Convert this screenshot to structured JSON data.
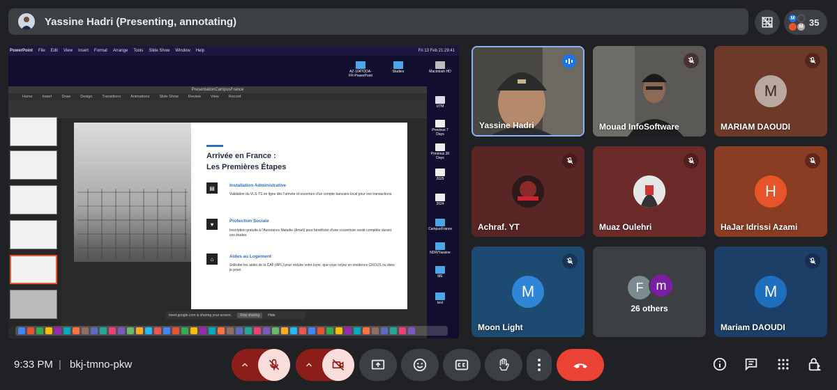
{
  "header": {
    "presenter_title": "Yassine Hadri (Presenting, annotating)",
    "participant_count": "35",
    "people_avatars": [
      "M",
      "M"
    ]
  },
  "presentation": {
    "mac_menu": [
      "PowerPoint",
      "File",
      "Edit",
      "View",
      "Insert",
      "Format",
      "Arrange",
      "Tools",
      "Slide Show",
      "Window",
      "Help"
    ],
    "mac_status": "Fri 13 Feb 21:29:41",
    "window_title": "PresentationCampusFrance",
    "tabs": [
      "Home",
      "Insert",
      "Draw",
      "Design",
      "Transitions",
      "Animations",
      "Slide Show",
      "Review",
      "View",
      "Record"
    ],
    "slide": {
      "title_line1": "Arrivée en France :",
      "title_line2": "Les Premières Étapes",
      "items": [
        {
          "heading": "Installation Administrative",
          "body": "Validation du VLS-TS en ligne dès l'arrivée et ouverture d'un compte bancaire local pour vos transactions."
        },
        {
          "heading": "Protection Sociale",
          "body": "Inscription gratuite à l'Assurance Maladie (Ameli) pour bénéficier d'une couverture santé complète durant vos études."
        },
        {
          "heading": "Aides au Logement",
          "body": "Solliciter les aides de la CAF (APL) pour réduire votre loyer, que vous soyez en résidence CROUS ou dans le privé."
        }
      ]
    },
    "share_notice": "meet.google.com is sharing your screen.",
    "stop_sharing": "Stop sharing",
    "hide": "Hide",
    "desktop_icons": [
      "AZ-104TODA-FR-PowerPoint",
      "Studies",
      "Macintosh HD",
      "UTM",
      "Previous 7 Days",
      "Previous 30 Days",
      "2025",
      "2024",
      "CampusFrance",
      "NDR/Yassine",
      "ME",
      "test"
    ]
  },
  "participants": [
    {
      "name": "Yassine Hadri",
      "type": "video",
      "speaking": true
    },
    {
      "name": "Mouad InfoSoftware",
      "type": "video",
      "muted": true
    },
    {
      "name": "MARIAM DAOUDI",
      "type": "avatar",
      "initial": "M",
      "muted": true,
      "bg": "#6d3a2a",
      "avatar_bg": "#b8a8a0"
    },
    {
      "name": "Achraf. YT",
      "type": "image",
      "muted": true,
      "bg": "#5a2525"
    },
    {
      "name": "Muaz Oulehri",
      "type": "image",
      "muted": true,
      "bg": "#6b2b2b"
    },
    {
      "name": "HaJar Idrissi Azami",
      "type": "avatar",
      "initial": "H",
      "muted": true,
      "bg": "#8a3d22",
      "avatar_bg": "#e8542a"
    },
    {
      "name": "Moon Light",
      "type": "avatar",
      "initial": "M",
      "muted": true,
      "bg": "#1d4a70",
      "avatar_bg": "#2f86d6"
    },
    {
      "name": "26 others",
      "type": "group",
      "initials": [
        "F",
        "m"
      ]
    },
    {
      "name": "Mariam DAOUDI",
      "type": "avatar",
      "initial": "M",
      "muted": true,
      "bg": "#1b3f66",
      "avatar_bg": "#1f6fbf"
    }
  ],
  "footer": {
    "time": "9:33 PM",
    "separator": "|",
    "meeting_code": "bkj-tmno-pkw"
  },
  "colors": {
    "end_call": "#ea4335",
    "mic_off_bg": "#f9dedc",
    "chevron_bg": "#8c1d18"
  }
}
